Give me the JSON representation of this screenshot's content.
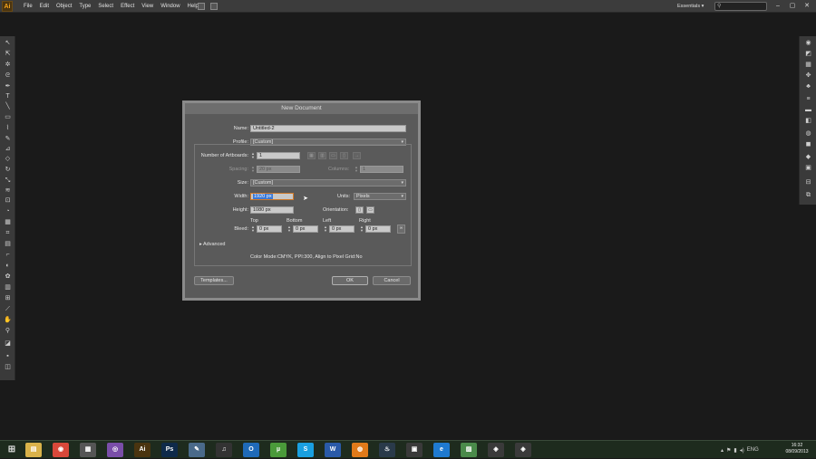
{
  "app": {
    "logo": "Ai",
    "menus": [
      "File",
      "Edit",
      "Object",
      "Type",
      "Select",
      "Effect",
      "View",
      "Window",
      "Help"
    ],
    "workspace": "Essentials",
    "window_controls": [
      "–",
      "▢",
      "✕"
    ]
  },
  "dialog": {
    "title": "New Document",
    "name_label": "Name:",
    "name_value": "Untitled-2",
    "profile_label": "Profile:",
    "profile_value": "[Custom]",
    "artboards_label": "Number of Artboards:",
    "artboards_value": "1",
    "spacing_label": "Spacing:",
    "spacing_value": "20 px",
    "columns_label": "Columns:",
    "columns_value": "1",
    "size_label": "Size:",
    "size_value": "[Custom]",
    "width_label": "Width:",
    "width_value": "1920 px",
    "units_label": "Units:",
    "units_value": "Pixels",
    "height_label": "Height:",
    "height_value": "1080 px",
    "orientation_label": "Orientation:",
    "bleed_label": "Bleed:",
    "bleed_headers": [
      "Top",
      "Bottom",
      "Left",
      "Right"
    ],
    "bleed_values": [
      "0 px",
      "0 px",
      "0 px",
      "0 px"
    ],
    "advanced_label": "Advanced",
    "info_text": "Color Mode:CMYK, PPI:300, Align to Pixel Grid:No",
    "templates_button": "Templates...",
    "ok_button": "OK",
    "cancel_button": "Cancel"
  },
  "taskbar": {
    "apps": [
      {
        "name": "explorer",
        "glyph": "▤",
        "color": "#d9b24a"
      },
      {
        "name": "chrome",
        "glyph": "◉",
        "color": "#d8483a"
      },
      {
        "name": "apps-grid",
        "glyph": "▦",
        "color": "#555555"
      },
      {
        "name": "app-circle",
        "glyph": "◎",
        "color": "#7a4ea8"
      },
      {
        "name": "illustrator",
        "glyph": "Ai",
        "color": "#4a3410"
      },
      {
        "name": "photoshop",
        "glyph": "Ps",
        "color": "#0f2a4a"
      },
      {
        "name": "pen-app",
        "glyph": "✎",
        "color": "#4a6a8a"
      },
      {
        "name": "itunes",
        "glyph": "♫",
        "color": "#333333"
      },
      {
        "name": "outlook",
        "glyph": "O",
        "color": "#1f6ab8"
      },
      {
        "name": "utorrent",
        "glyph": "µ",
        "color": "#4a9a3a"
      },
      {
        "name": "skype",
        "glyph": "S",
        "color": "#1aa0e0"
      },
      {
        "name": "word",
        "glyph": "W",
        "color": "#2a5aa8"
      },
      {
        "name": "firefox",
        "glyph": "◍",
        "color": "#e07a1a"
      },
      {
        "name": "steam",
        "glyph": "♨",
        "color": "#2a3a4a"
      },
      {
        "name": "media-app",
        "glyph": "▣",
        "color": "#3a3a3a"
      },
      {
        "name": "ie",
        "glyph": "e",
        "color": "#1f7ad0"
      },
      {
        "name": "image-app",
        "glyph": "▨",
        "color": "#4a8a4a"
      },
      {
        "name": "app-ticket",
        "glyph": "◈",
        "color": "#3a3a3a"
      },
      {
        "name": "app-ticket-2",
        "glyph": "◈",
        "color": "#3a3a3a"
      }
    ],
    "lang": "ENG",
    "time": "16:32",
    "date": "08/09/2013"
  }
}
